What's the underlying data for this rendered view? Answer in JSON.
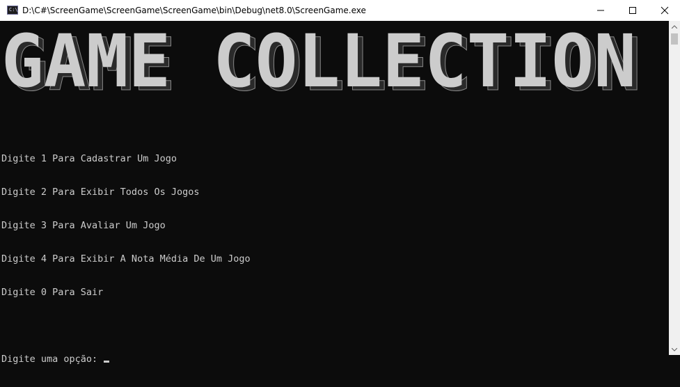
{
  "window": {
    "title": "D:\\C#\\ScreenGame\\ScreenGame\\ScreenGame\\bin\\Debug\\net8.0\\ScreenGame.exe",
    "icon": "console-app-icon",
    "icon_glyph": "C:\\"
  },
  "controls": {
    "minimize_icon": "minimize-icon",
    "maximize_icon": "maximize-icon",
    "close_icon": "close-icon"
  },
  "banner": {
    "text": "GAME COLLECTION"
  },
  "menu": {
    "options": [
      "Digite 1 Para Cadastrar Um Jogo",
      "Digite 2 Para Exibir Todos Os Jogos",
      "Digite 3 Para Avaliar Um Jogo",
      "Digite 4 Para Exibir A Nota Média De Um Jogo",
      "Digite 0 Para Sair"
    ],
    "prompt": "Digite uma opção: "
  },
  "colors": {
    "background": "#0c0c0c",
    "text": "#cccccc",
    "banner_fill": "#cccccc"
  }
}
